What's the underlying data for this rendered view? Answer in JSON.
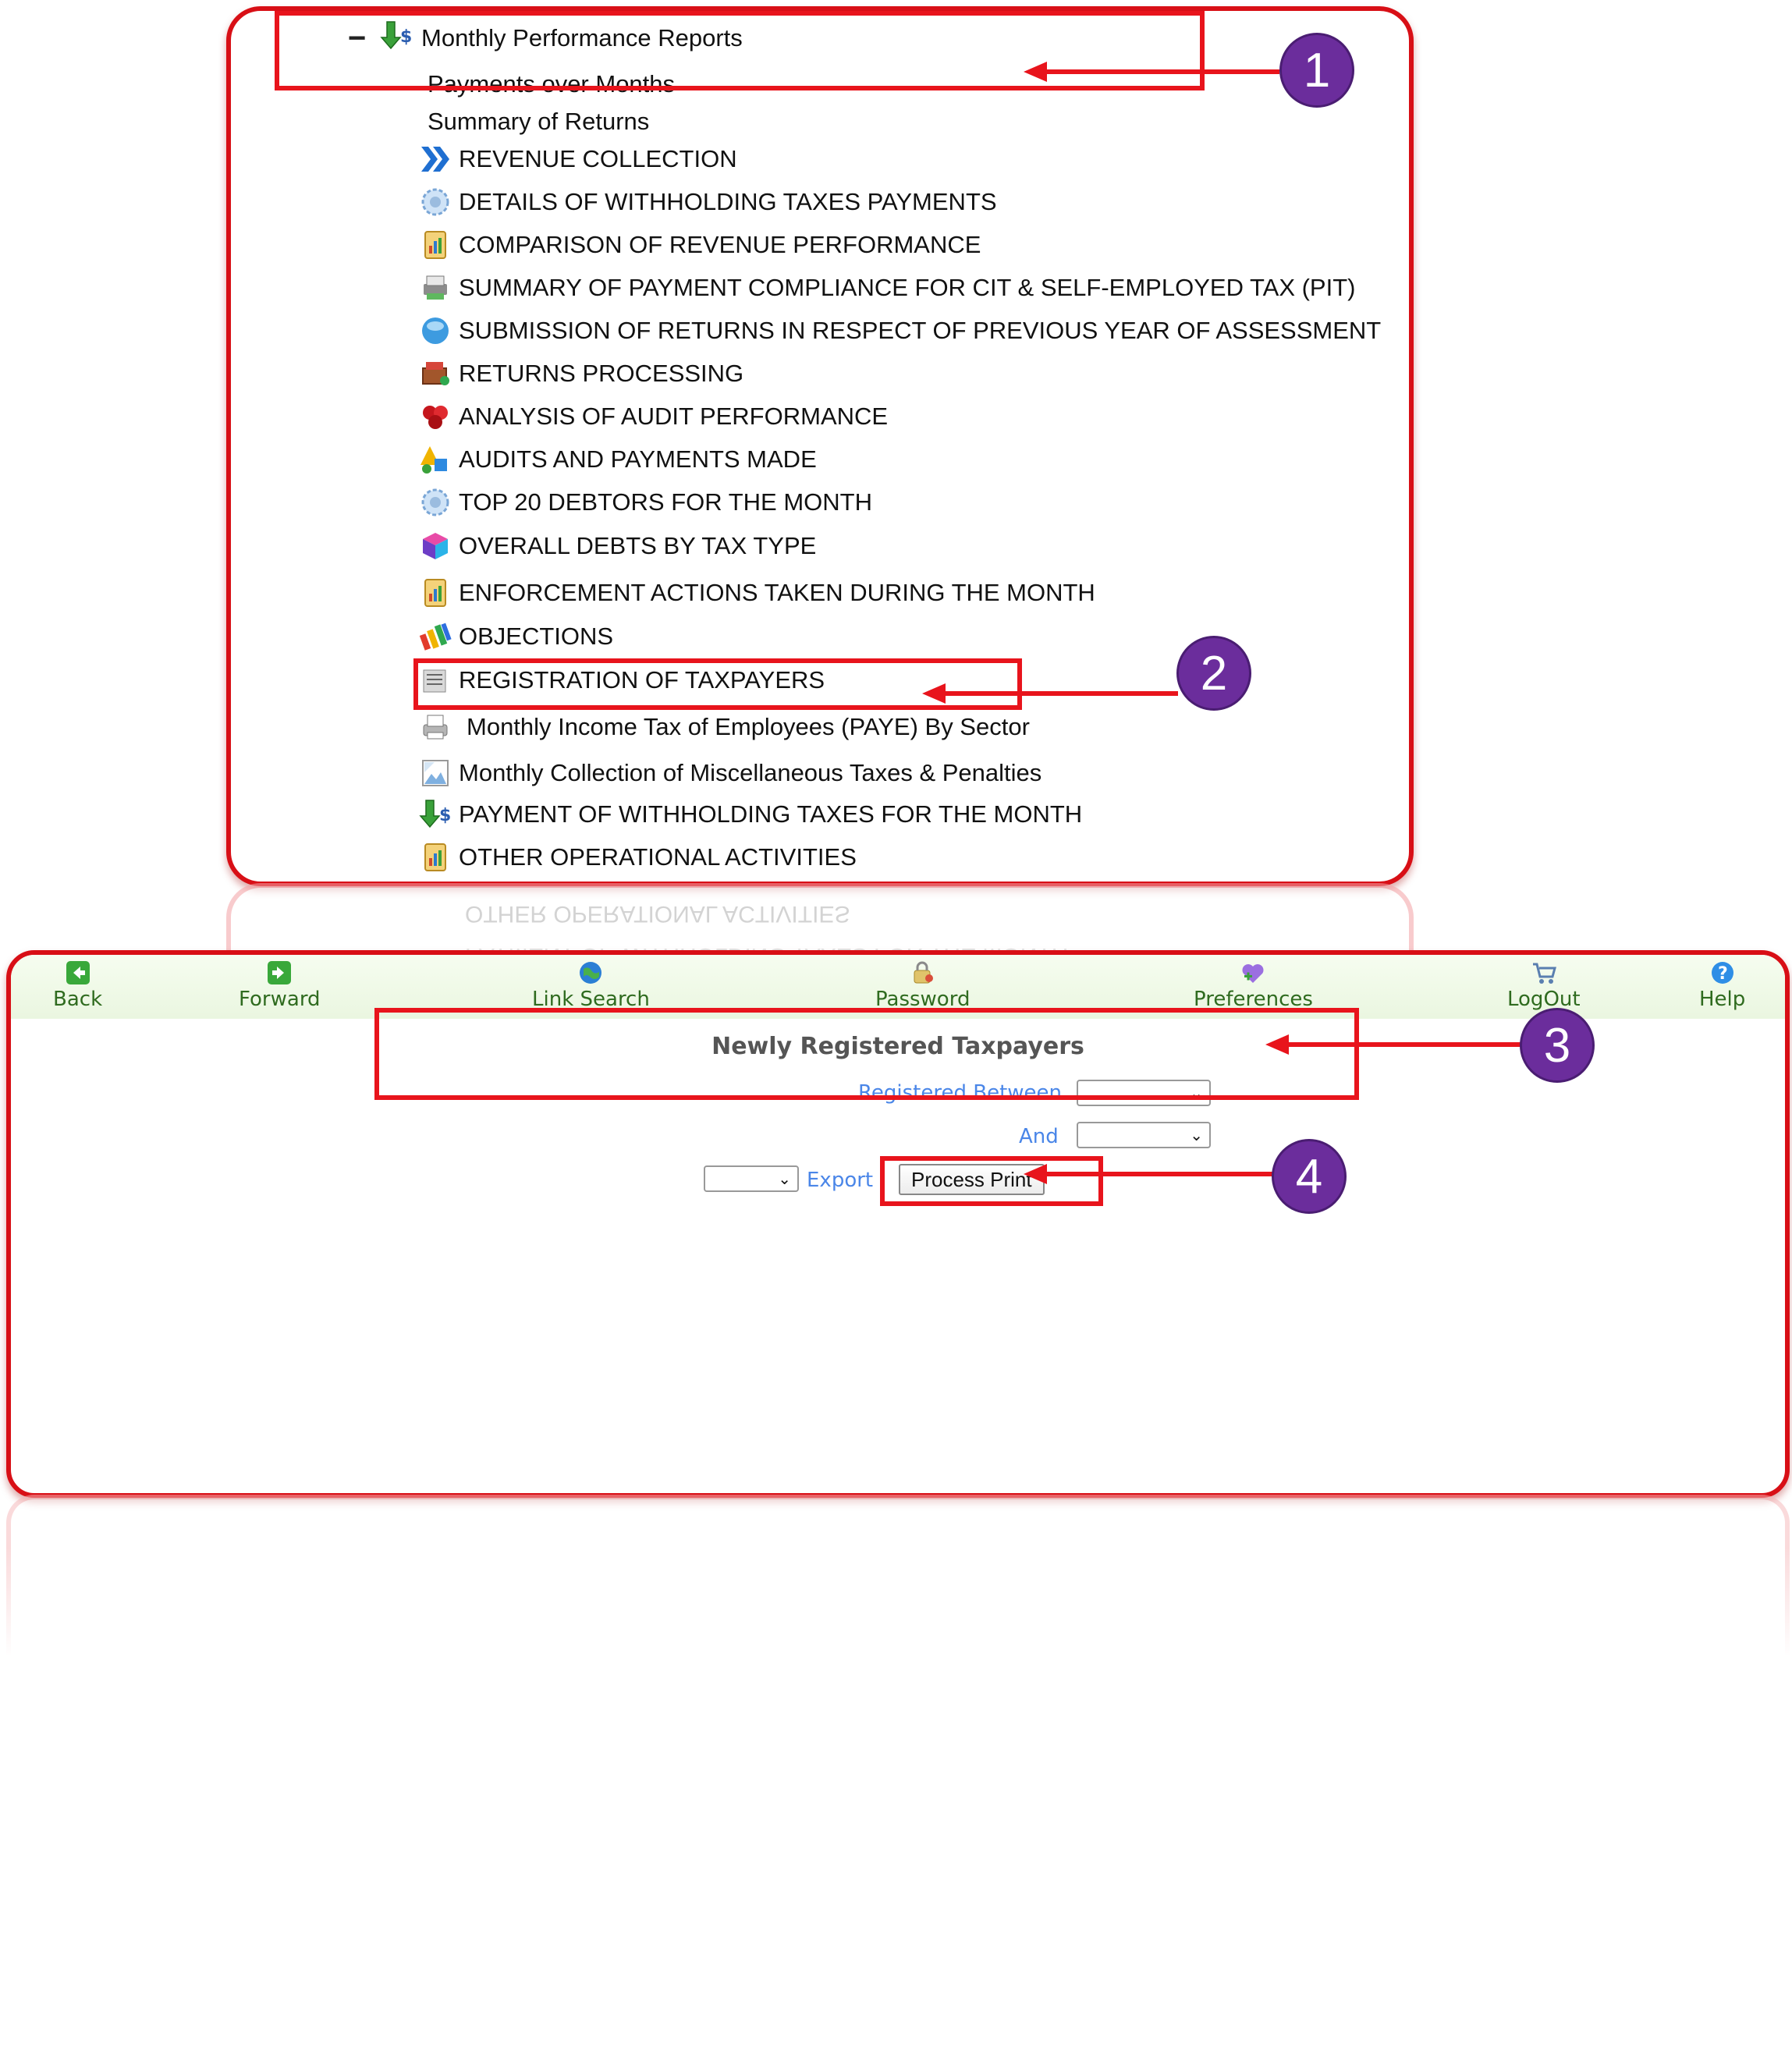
{
  "tree": {
    "root_label": "Monthly Performance Reports",
    "sub_items": [
      "Payments over Months",
      "Summary of Returns"
    ],
    "reports": [
      {
        "label": "REVENUE COLLECTION",
        "icon": "double-chevron-icon"
      },
      {
        "label": "DETAILS OF WITHHOLDING TAXES PAYMENTS",
        "icon": "globe-gear-icon"
      },
      {
        "label": "COMPARISON OF REVENUE PERFORMANCE",
        "icon": "clipboard-chart-icon"
      },
      {
        "label": "SUMMARY OF PAYMENT COMPLIANCE FOR CIT & SELF-EMPLOYED TAX (PIT)",
        "icon": "printer-stack-icon"
      },
      {
        "label": "SUBMISSION OF RETURNS IN RESPECT OF PREVIOUS YEAR OF ASSESSMENT",
        "icon": "blue-orb-icon"
      },
      {
        "label": "RETURNS PROCESSING",
        "icon": "box-stack-icon"
      },
      {
        "label": "ANALYSIS OF AUDIT PERFORMANCE",
        "icon": "red-flower-icon"
      },
      {
        "label": "AUDITS AND PAYMENTS MADE",
        "icon": "colored-shapes-icon"
      },
      {
        "label": "TOP 20 DEBTORS FOR THE MONTH",
        "icon": "globe-gear-icon"
      },
      {
        "label": "OVERALL DEBTS BY TAX TYPE",
        "icon": "color-cube-icon"
      },
      {
        "label": "ENFORCEMENT ACTIONS TAKEN DURING THE MONTH",
        "icon": "clipboard-chart-icon"
      },
      {
        "label": "OBJECTIONS",
        "icon": "pencils-icon"
      },
      {
        "label": "REGISTRATION OF TAXPAYERS",
        "icon": "document-stack-icon"
      },
      {
        "label": "Monthly Income Tax of Employees (PAYE) By Sector",
        "icon": "printer-icon"
      },
      {
        "label": "Monthly Collection of Miscellaneous Taxes & Penalties",
        "icon": "broken-image-icon"
      },
      {
        "label": "PAYMENT OF WITHHOLDING TAXES FOR THE MONTH",
        "icon": "money-arrow-icon"
      },
      {
        "label": "OTHER OPERATIONAL ACTIVITIES",
        "icon": "clipboard-chart-icon"
      }
    ]
  },
  "toolbar": {
    "back": "Back",
    "forward": "Forward",
    "link_search": "Link Search",
    "password": "Password",
    "preferences": "Preferences",
    "logout": "LogOut",
    "help": "Help"
  },
  "page": {
    "title": "Newly Registered Taxpayers",
    "registered_between_label": "Registered Between",
    "and_label": "And",
    "export_label": "Export",
    "process_print_label": "Process Print"
  },
  "annotations": {
    "badges": [
      "1",
      "2",
      "3",
      "4"
    ],
    "color": "#e8141c",
    "badge_color": "#6b2d9c"
  }
}
